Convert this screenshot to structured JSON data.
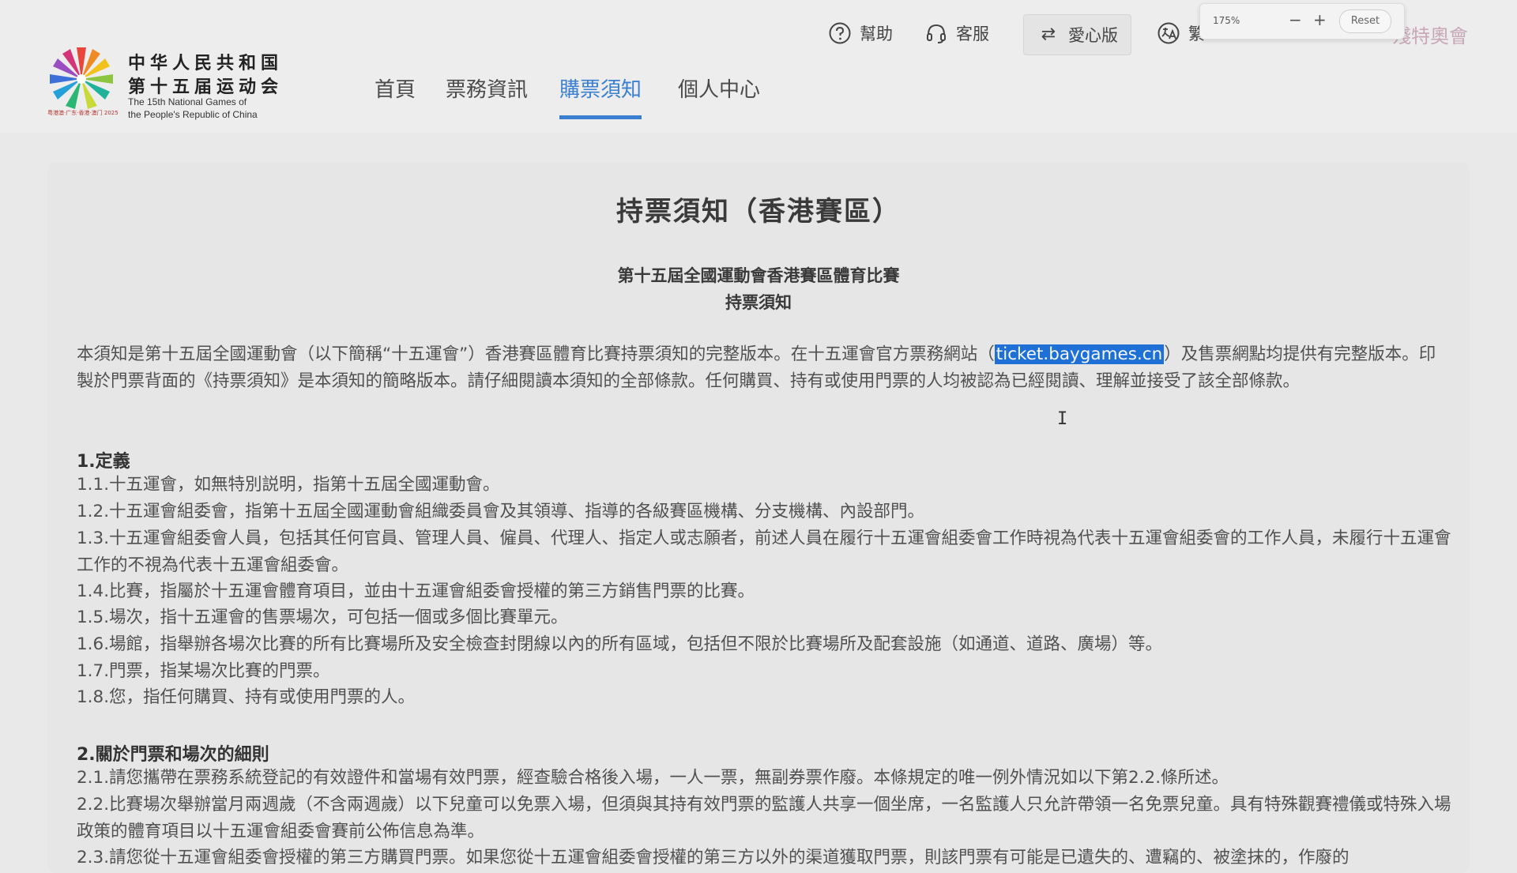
{
  "header": {
    "logo": {
      "cn_line1": "中华人民共和国",
      "cn_line2": "第十五届运动会",
      "en_line1": "The 15th National Games of",
      "en_line2": "the People's Republic of China",
      "tag": "粤港澳·广东·香港·澳门 2025"
    },
    "nav": [
      {
        "label": "首頁"
      },
      {
        "label": "票務資訊"
      },
      {
        "label": "購票須知"
      },
      {
        "label": "個人中心"
      }
    ],
    "tools": {
      "help": "幫助",
      "service": "客服",
      "care": "愛心版",
      "lang": "繁",
      "brand": "殘特奧會"
    },
    "zoom": {
      "level": "175%",
      "minus": "−",
      "plus": "+",
      "reset": "Reset"
    }
  },
  "doc": {
    "title": "持票須知（香港賽區）",
    "subtitle1": "第十五屆全國運動會香港賽區體育比賽",
    "subtitle2": "持票須知",
    "intro_before": "本須知是第十五屆全國運動會（以下簡稱“十五運會”）香港賽區體育比賽持票須知的完整版本。在十五運會官方票務網站（",
    "intro_link": "ticket.baygames.cn",
    "intro_after": "）及售票網點均提供有完整版本。印製於門票背面的《持票須知》是本須知的簡略版本。請仔細閱讀本須知的全部條款。任何購買、持有或使用門票的人均被認為已經閱讀、理解並接受了該全部條款。",
    "s1_heading": "1.定義",
    "s1": [
      "1.1.十五運會，如無特別説明，指第十五屆全國運動會。",
      "1.2.十五運會組委會，指第十五屆全國運動會組織委員會及其領導、指導的各級賽區機構、分支機構、內設部門。",
      "1.3.十五運會組委會人員，包括其任何官員、管理人員、僱員、代理人、指定人或志願者，前述人員在履行十五運會組委會工作時視為代表十五運會組委會的工作人員，未履行十五運會工作的不視為代表十五運會組委會。",
      "1.4.比賽，指屬於十五運會體育項目，並由十五運會組委會授權的第三方銷售門票的比賽。",
      "1.5.場次，指十五運會的售票場次，可包括一個或多個比賽單元。",
      "1.6.場館，指舉辦各場次比賽的所有比賽場所及安全檢查封閉線以內的所有區域，包括但不限於比賽場所及配套設施（如通道、道路、廣場）等。",
      "1.7.門票，指某場次比賽的門票。",
      "1.8.您，指任何購買、持有或使用門票的人。"
    ],
    "s2_heading": "2.關於門票和場次的細則",
    "s2": [
      "2.1.請您攜帶在票務系統登記的有效證件和當場有效門票，經查驗合格後入場，一人一票，無副券票作廢。本條規定的唯一例外情況如以下第2.2.條所述。",
      "2.2.比賽場次舉辦當月兩週歲（不含兩週歲）以下兒童可以免票入場，但須與其持有效門票的監護人共享一個坐席，一名監護人只允許帶領一名免票兒童。具有特殊觀賽禮儀或特殊入場政策的體育項目以十五運會組委會賽前公佈信息為準。",
      "2.3.請您從十五運會組委會授權的第三方購買門票。如果您從十五運會組委會授權的第三方以外的渠道獲取門票，則該門票有可能是已遺失的、遭竊的、被塗抹的，作廢的"
    ]
  }
}
